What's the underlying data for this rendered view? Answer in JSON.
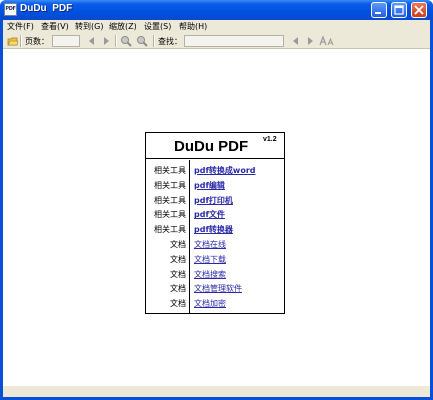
{
  "window": {
    "title": "DuDu  PDF",
    "icon_text": "PDF",
    "controls": [
      "minimize-icon",
      "maximize-icon",
      "close-icon"
    ]
  },
  "menubar": {
    "items": [
      {
        "label": "文件(F)"
      },
      {
        "label": "查看(V)"
      },
      {
        "label": "转到(G)"
      },
      {
        "label": "缩放(Z)"
      },
      {
        "label": "设置(S)"
      },
      {
        "label": "帮助(H)"
      }
    ]
  },
  "toolbar": {
    "page_label": "页数：",
    "page_value": "",
    "search_label": "查找：",
    "search_value": ""
  },
  "card": {
    "title": "DuDu PDF",
    "version": "v1.2",
    "rows": [
      {
        "label": "相关工具",
        "link": "pdf转换成word",
        "bold": true
      },
      {
        "label": "相关工具",
        "link": "pdf编辑",
        "bold": true
      },
      {
        "label": "相关工具",
        "link": "pdf打印机",
        "bold": true
      },
      {
        "label": "相关工具",
        "link": "pdf文件",
        "bold": true
      },
      {
        "label": "相关工具",
        "link": "pdf转换器",
        "bold": true
      },
      {
        "label": "文档",
        "link": "文档在线",
        "bold": false
      },
      {
        "label": "文档",
        "link": "文档下载",
        "bold": false
      },
      {
        "label": "文档",
        "link": "文档搜索",
        "bold": false
      },
      {
        "label": "文档",
        "link": "文档管理软件",
        "bold": false
      },
      {
        "label": "文档",
        "link": "文档加密",
        "bold": false
      }
    ]
  },
  "colors": {
    "titlebar": "#0050e0",
    "chrome": "#ece9d8",
    "link": "#2a2aa8"
  }
}
